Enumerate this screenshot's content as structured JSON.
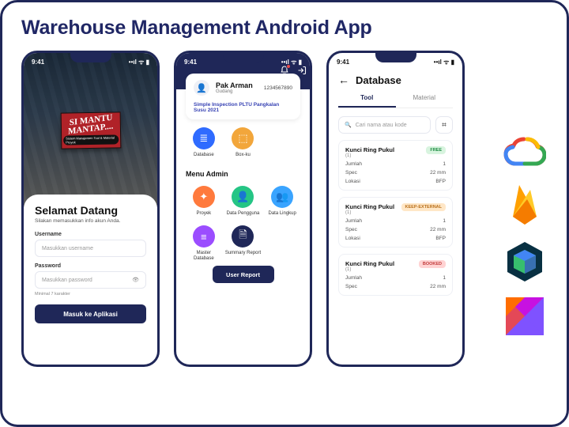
{
  "title": "Warehouse Management Android App",
  "statusbar": {
    "time": "9:41",
    "icons": "••ıl ᯤ ▮"
  },
  "logo_banner": {
    "line1": "SI MANTU",
    "line2": "MANTAP....",
    "subtitle": "Sistem Manajemen Tool & Material Proyek"
  },
  "login": {
    "welcome": "Selamat Datang",
    "subtitle": "Silakan memasukkan info akun Anda.",
    "username_label": "Username",
    "username_placeholder": "Masukkan username",
    "password_label": "Password",
    "password_placeholder": "Masukkan password",
    "password_hint": "Minimal 7 karakter",
    "submit_label": "Masuk ke Aplikasi"
  },
  "dashboard": {
    "user_name": "Pak Arman",
    "user_role": "Gudang",
    "user_phone": "1234567890",
    "inspection_text": "Simple Inspection PLTU Pangkalan Susu 2021",
    "top_menu": [
      {
        "label": "Database",
        "icon": "≣",
        "color": "#2f6bff"
      },
      {
        "label": "Box-ku",
        "icon": "⬚",
        "color": "#f2a63b"
      }
    ],
    "admin_section_title": "Menu Admin",
    "admin_menu": [
      {
        "label": "Proyek",
        "icon": "✦",
        "color": "#ff7a3d"
      },
      {
        "label": "Data Pengguna",
        "icon": "👤",
        "color": "#25c585"
      },
      {
        "label": "Data Lingkup",
        "icon": "👥",
        "color": "#3aa4ff"
      },
      {
        "label": "Master Database",
        "icon": "≡",
        "color": "#9b4dff"
      },
      {
        "label": "Summary Report",
        "icon": "🗎",
        "color": "#1f2758"
      }
    ],
    "user_report_label": "User Report"
  },
  "database": {
    "page_title": "Database",
    "tabs": {
      "tool": "Tool",
      "material": "Material",
      "active": "tool"
    },
    "search_placeholder": "Cari nama atau kode",
    "items": [
      {
        "name": "Kunci Ring Pukul",
        "count": "(1)",
        "badge": {
          "text": "FREE",
          "cls": "green"
        },
        "attrs": [
          {
            "k": "Jumlah",
            "v": "1"
          },
          {
            "k": "Spec",
            "v": "22 mm"
          },
          {
            "k": "Lokasi",
            "v": "BFP"
          }
        ]
      },
      {
        "name": "Kunci Ring Pukul",
        "count": "(1)",
        "badge": {
          "text": "KEEP-EXTERNAL",
          "cls": "orange"
        },
        "attrs": [
          {
            "k": "Jumlah",
            "v": "1"
          },
          {
            "k": "Spec",
            "v": "22 mm"
          },
          {
            "k": "Lokasi",
            "v": "BFP"
          }
        ]
      },
      {
        "name": "Kunci Ring Pukul",
        "count": "(1)",
        "badge": {
          "text": "BOOKED",
          "cls": "red"
        },
        "attrs": [
          {
            "k": "Jumlah",
            "v": "1"
          },
          {
            "k": "Spec",
            "v": "22 mm"
          }
        ]
      }
    ]
  }
}
